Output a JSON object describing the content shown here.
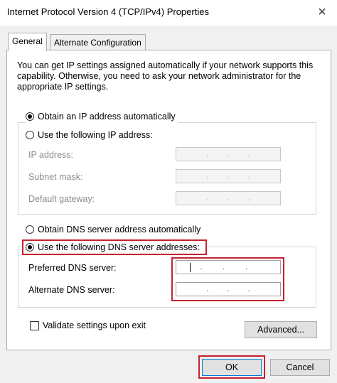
{
  "window": {
    "title": "Internet Protocol Version 4 (TCP/IPv4) Properties",
    "close_glyph": "×"
  },
  "tabs": [
    {
      "label": "General",
      "active": true
    },
    {
      "label": "Alternate Configuration",
      "active": false
    }
  ],
  "description": "You can get IP settings assigned automatically if your network supports this capability. Otherwise, you need to ask your network administrator for the appropriate IP settings.",
  "ip_section": {
    "auto_label": "Obtain an IP address automatically",
    "auto_selected": true,
    "manual_label": "Use the following IP address:",
    "manual_selected": false,
    "fields": [
      {
        "label": "IP address:",
        "value": ". . ."
      },
      {
        "label": "Subnet mask:",
        "value": ". . ."
      },
      {
        "label": "Default gateway:",
        "value": ". . ."
      }
    ]
  },
  "dns_section": {
    "auto_label": "Obtain DNS server address automatically",
    "auto_selected": false,
    "manual_label": "Use the following DNS server addresses:",
    "manual_selected": true,
    "preferred_label": "Preferred DNS server:",
    "alternate_label": "Alternate DNS server:",
    "dot": "."
  },
  "validate_label": "Validate settings upon exit",
  "validate_checked": false,
  "buttons": {
    "advanced": "Advanced...",
    "ok": "OK",
    "cancel": "Cancel"
  },
  "colors": {
    "highlight": "#c4232f",
    "focus": "#0078d7"
  }
}
